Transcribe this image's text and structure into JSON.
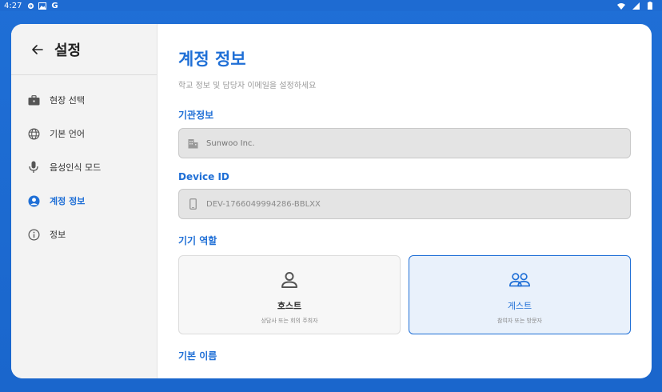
{
  "status_bar": {
    "time": "4:27"
  },
  "sidebar": {
    "title": "설정",
    "items": [
      {
        "label": "현장 선택",
        "icon": "briefcase-icon"
      },
      {
        "label": "기본 언어",
        "icon": "globe-icon"
      },
      {
        "label": "음성인식 모드",
        "icon": "microphone-icon"
      },
      {
        "label": "계정 정보",
        "icon": "account-circle-icon",
        "active": true
      },
      {
        "label": "정보",
        "icon": "info-icon"
      }
    ]
  },
  "main": {
    "title": "계정 정보",
    "subtitle": "학교 정보 및 담당자 이메일을 설정하세요",
    "org": {
      "label": "기관정보",
      "placeholder": "Sunwoo Inc."
    },
    "device": {
      "label": "Device ID",
      "value": "DEV-1766049994286-BBLXX"
    },
    "role": {
      "label": "기기 역할",
      "selected": "guest",
      "host": {
        "title": "호스트",
        "desc": "상담사 또는 회의 주최자"
      },
      "guest": {
        "title": "게스트",
        "desc": "참여자 또는 방문자"
      }
    },
    "default_name_label": "기본 이름"
  },
  "colors": {
    "accent": "#1f6fd6",
    "background": "#1a66cc"
  }
}
